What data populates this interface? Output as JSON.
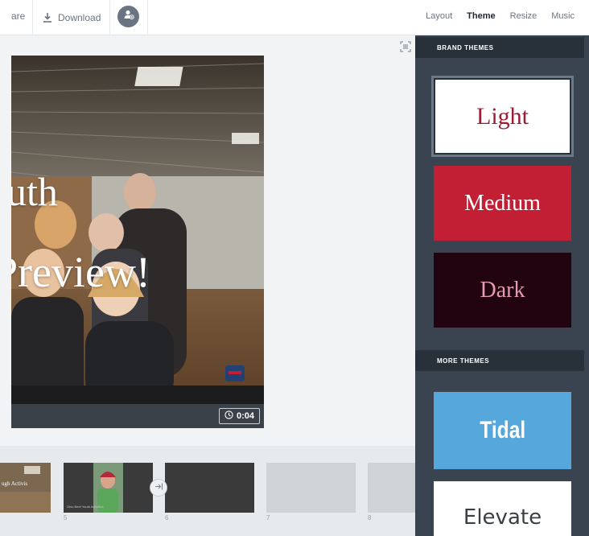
{
  "toolbar": {
    "share_label": "are",
    "download_label": "Download",
    "tabs": [
      {
        "label": "Layout",
        "active": false
      },
      {
        "label": "Theme",
        "active": true
      },
      {
        "label": "Resize",
        "active": false
      },
      {
        "label": "Music",
        "active": false
      }
    ]
  },
  "slide": {
    "title_line1": "uth",
    "title_line2": "Preview!",
    "duration": "0:04"
  },
  "filmstrip": {
    "thumbs": [
      {
        "number": "",
        "caption": "ugh Activis"
      },
      {
        "number": "5",
        "caption": "Ohio Beef Youth Activities"
      },
      {
        "number": "6",
        "caption": ""
      },
      {
        "number": "7",
        "caption": ""
      },
      {
        "number": "8",
        "caption": ""
      }
    ]
  },
  "panel": {
    "brand_header": "BRAND THEMES",
    "more_header": "MORE THEMES",
    "brand_themes": [
      {
        "label": "Light",
        "selected": true
      },
      {
        "label": "Medium",
        "selected": false
      },
      {
        "label": "Dark",
        "selected": false
      }
    ],
    "more_themes": [
      {
        "label": "Tidal"
      },
      {
        "label": "Elevate"
      }
    ]
  },
  "colors": {
    "light_text": "#9e1b32",
    "medium_bg": "#c21f35",
    "dark_bg": "#210410",
    "dark_text": "#e79ab0",
    "tidal_bg": "#56a7db",
    "panel_bg": "#3a4450",
    "panel_header_bg": "#283039"
  },
  "icons": {
    "download": "download-icon",
    "avatar": "user-add-icon",
    "fullscreen": "fullscreen-icon",
    "clock": "clock-icon",
    "transition": "transition-icon"
  }
}
